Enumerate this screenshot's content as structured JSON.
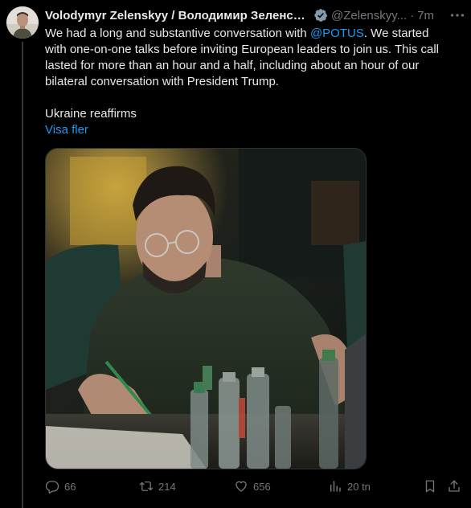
{
  "tweet": {
    "author": {
      "display_name": "Volodymyr Zelenskyy / Володимир Зеленсь...",
      "handle": "@Zelenskyy...",
      "time": "7m",
      "verified": true
    },
    "text": {
      "line_before_mention": "We had a long and substantive conversation with ",
      "mention": "@POTUS",
      "line_after_mention": ". We started with one-on-one talks before inviting European leaders to join us. This call lasted for more than an hour and a half, including about an hour of our bilateral conversation with President Trump.",
      "second_paragraph": "Ukraine reaffirms",
      "show_more": "Visa fler"
    },
    "media": {
      "type": "photo",
      "subject": "man in dark t-shirt with glasses writing at desk with bottles"
    },
    "actions": {
      "replies": "66",
      "reposts": "214",
      "likes": "656",
      "views": "20 tn"
    }
  },
  "icons": {
    "reply": "reply-icon",
    "repost": "repost-icon",
    "like": "heart-icon",
    "views": "views-icon",
    "bookmark": "bookmark-icon",
    "share": "share-icon",
    "verified": "verified-badge-icon",
    "more": "more-icon"
  },
  "colors": {
    "background": "#000000",
    "text": "#e7e9ea",
    "secondary": "#71767b",
    "link": "#1d9bf0",
    "border": "#2f3336"
  }
}
